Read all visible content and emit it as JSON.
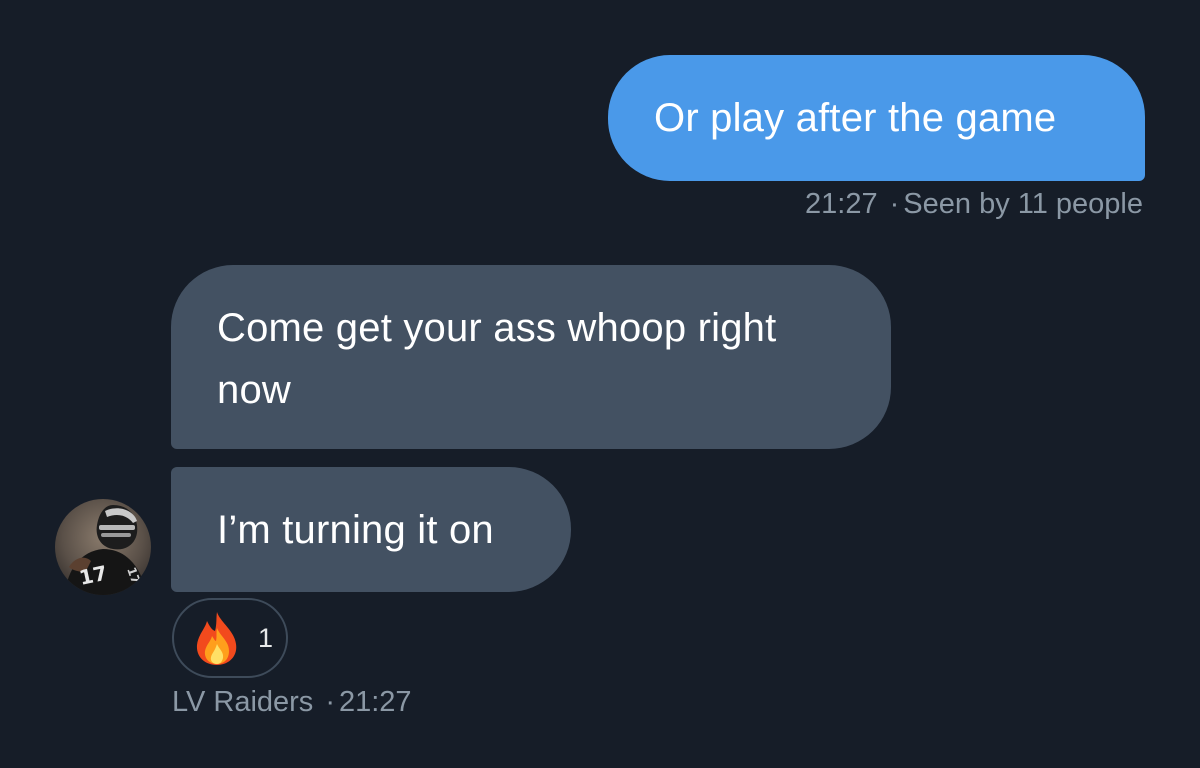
{
  "messages": {
    "sent": {
      "text": "Or play after the game",
      "time": "21:27",
      "separator": "·",
      "seen": "Seen by 11 people"
    },
    "received": [
      {
        "text": "Come get your ass whoop right now"
      },
      {
        "text": "I’m turning it on"
      }
    ],
    "reaction": {
      "emoji": "fire-icon",
      "count": "1"
    },
    "sender": {
      "name": "LV Raiders",
      "separator": "·",
      "time": "21:27",
      "avatar": "player-avatar"
    }
  },
  "colors": {
    "background": "#161d28",
    "sent_bubble": "#4a99e9",
    "received_bubble": "#435162",
    "meta_text": "#8b98a5"
  }
}
